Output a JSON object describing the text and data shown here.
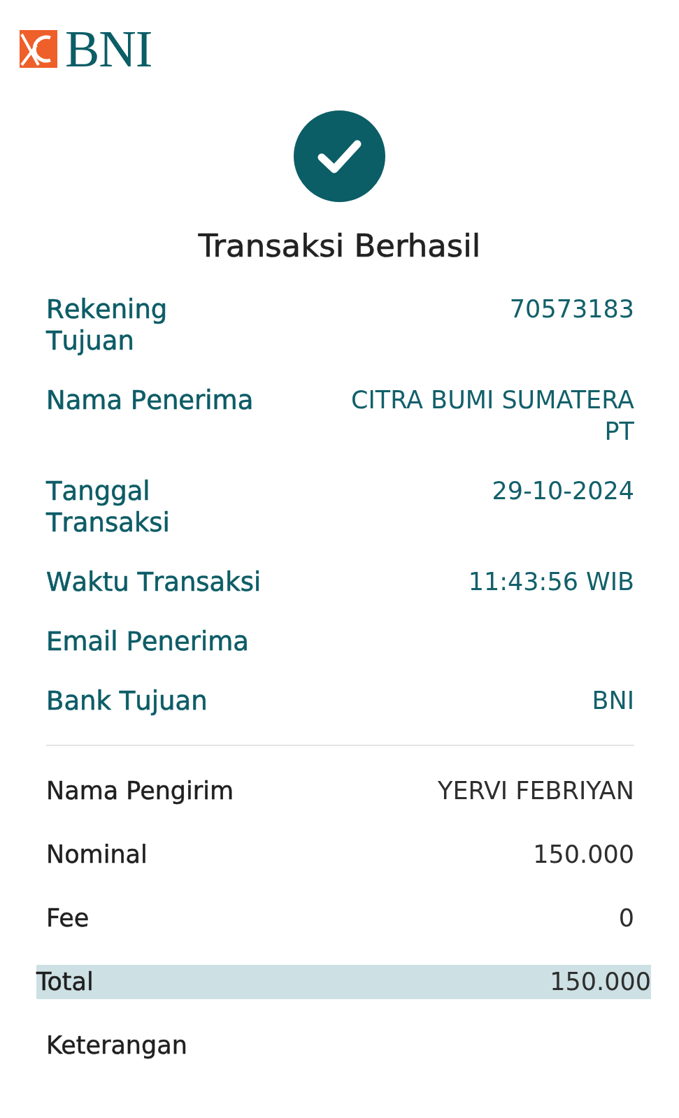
{
  "logo": {
    "text": "BNI"
  },
  "title": "Transaksi Berhasil",
  "recipient_details": [
    {
      "label": "Rekening Tujuan",
      "value": "70573183"
    },
    {
      "label": "Nama Penerima",
      "value": "CITRA BUMI SUMATERA PT"
    },
    {
      "label": "Tanggal Transaksi",
      "value": "29-10-2024"
    },
    {
      "label": "Waktu Transaksi",
      "value": "11:43:56 WIB"
    },
    {
      "label": "Email Penerima"
    },
    {
      "label": "Bank Tujuan",
      "value": "BNI"
    }
  ],
  "transfer_details": [
    {
      "label": "Nama Pengirim",
      "value": "YERVI FEBRIYAN",
      "highlighted": false
    },
    {
      "label": "Nominal",
      "value": "150.000",
      "highlighted": false
    },
    {
      "label": "Fee",
      "value": "0",
      "highlighted": false
    },
    {
      "label": "Total",
      "value": "150.000",
      "highlighted": true
    },
    {
      "label": "Keterangan",
      "highlighted": false
    }
  ]
}
